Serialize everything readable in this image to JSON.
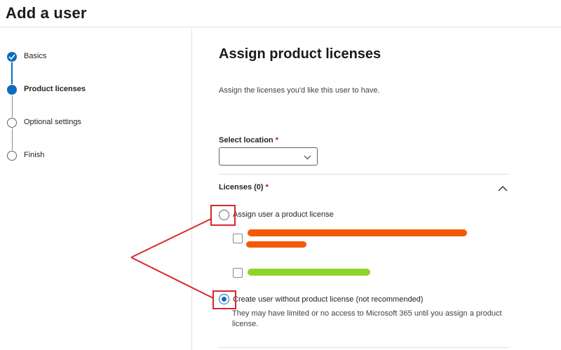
{
  "header": {
    "title": "Add a user"
  },
  "steps": [
    {
      "label": "Basics",
      "status": "done"
    },
    {
      "label": "Product licenses",
      "status": "current"
    },
    {
      "label": "Optional settings",
      "status": "todo"
    },
    {
      "label": "Finish",
      "status": "todo"
    }
  ],
  "main": {
    "title": "Assign product licenses",
    "description": "Assign the licenses you'd like this user to have.",
    "location": {
      "label": "Select location",
      "required_mark": "*",
      "value": ""
    },
    "licenses": {
      "header": "Licenses (0)",
      "required_mark": "*",
      "options": [
        {
          "label": "Assign user a product license",
          "selected": false
        },
        {
          "label": "Create user without product license (not recommended)",
          "selected": true
        }
      ],
      "note": "They may have limited or no access to Microsoft 365 until you assign a product license."
    }
  },
  "colors": {
    "accent": "#0f6cbd",
    "annotation_red": "#d9262b",
    "redaction_orange": "#f25a0a",
    "redaction_green": "#8fd42a"
  }
}
